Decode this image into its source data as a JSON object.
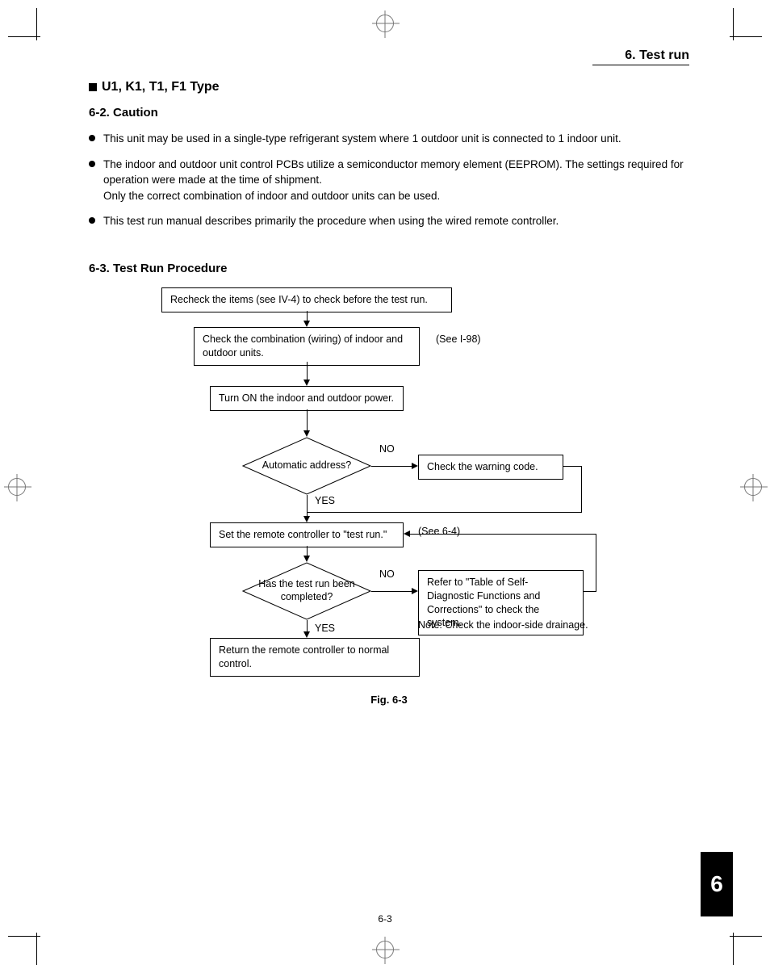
{
  "header": {
    "section": "6. Test run"
  },
  "type_heading": "U1, K1, T1, F1 Type",
  "section_caution": {
    "heading": "6-2. Caution"
  },
  "bullets": [
    "This unit may be used in a single-type refrigerant system where 1 outdoor unit is connected to 1 indoor unit.",
    "The indoor and outdoor unit control PCBs utilize a semiconductor memory element (EEPROM). The settings required for operation were made at the time of shipment.\nOnly the correct combination of indoor and outdoor units can be used.",
    "This test run manual describes primarily the procedure when using the wired remote controller."
  ],
  "section_procedure": {
    "heading": "6-3. Test Run Procedure"
  },
  "flow": {
    "step1": "Recheck the items (see IV-4) to check before the test run.",
    "step2": "Check the combination (wiring) of indoor and outdoor units.",
    "step2_ref": "(See I-98)",
    "step3": "Turn ON the indoor and outdoor power.",
    "decision1": "Automatic address?",
    "d1_no": "NO",
    "d1_yes": "YES",
    "side1": "Check the warning code.",
    "step4": "Set the remote controller to \"test run.\"",
    "step4_ref": "(See 6-4)",
    "decision2": "Has the test run been completed?",
    "d2_no": "NO",
    "d2_yes": "YES",
    "side2": "Refer to \"Table of  Self-Diagnostic Functions and Corrections\" to check the system.",
    "note": "Note:   Check the indoor-side drainage.",
    "step5": "Return the remote controller to normal control."
  },
  "figure_caption": "Fig. 6-3",
  "page_number": "6-3",
  "chapter_tab": "6",
  "chart_data": {
    "type": "flowchart",
    "nodes": [
      {
        "id": "n1",
        "type": "process",
        "text": "Recheck the items (see IV-4) to check before the test run."
      },
      {
        "id": "n2",
        "type": "process",
        "text": "Check the combination (wiring) of indoor and outdoor units.",
        "annotation": "(See I-98)"
      },
      {
        "id": "n3",
        "type": "process",
        "text": "Turn ON the indoor and outdoor power."
      },
      {
        "id": "d1",
        "type": "decision",
        "text": "Automatic address?"
      },
      {
        "id": "s1",
        "type": "process",
        "text": "Check the warning code."
      },
      {
        "id": "n4",
        "type": "process",
        "text": "Set the remote controller to \"test run.\"",
        "annotation": "(See 6-4)"
      },
      {
        "id": "d2",
        "type": "decision",
        "text": "Has the test run been completed?"
      },
      {
        "id": "s2",
        "type": "process",
        "text": "Refer to \"Table of Self-Diagnostic Functions and Corrections\" to check the system.",
        "note": "Note: Check the indoor-side drainage."
      },
      {
        "id": "n5",
        "type": "process",
        "text": "Return the remote controller to normal control."
      }
    ],
    "edges": [
      {
        "from": "n1",
        "to": "n2"
      },
      {
        "from": "n2",
        "to": "n3"
      },
      {
        "from": "n3",
        "to": "d1"
      },
      {
        "from": "d1",
        "to": "s1",
        "label": "NO"
      },
      {
        "from": "d1",
        "to": "n4",
        "label": "YES"
      },
      {
        "from": "s1",
        "to": "n4"
      },
      {
        "from": "n4",
        "to": "d2"
      },
      {
        "from": "d2",
        "to": "s2",
        "label": "NO"
      },
      {
        "from": "d2",
        "to": "n5",
        "label": "YES"
      },
      {
        "from": "s2",
        "to": "n4"
      }
    ]
  }
}
